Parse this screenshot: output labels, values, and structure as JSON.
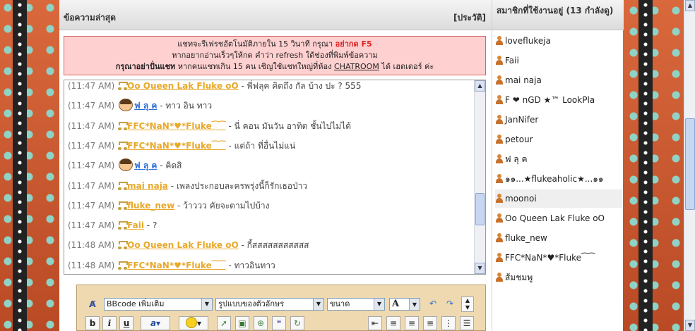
{
  "chat": {
    "header_title": "ข้อความล่าสุด",
    "history_link": "[ประวัติ]",
    "notice": {
      "line1_pre": "แชทจะรีเฟรชอัตโนมัติภายใน 15 วินาที กรุณา ",
      "line1_highlight": "อย่ากด F5",
      "line2": "หากอยากอ่านเร็วๆให้กด คำว่า refresh ใต้ช่องที่พิมพ์ข้อความ",
      "line3_bold": "กรุณาอย่าปั่นแชท",
      "line3_mid": " หากคนแชทเกิน 15 คน เชิญใช้แชทใหญ่ที่ห้อง ",
      "line3_link": "CHATROOM",
      "line3_post": " ได้ เฮดเดอร์ ค่ะ"
    },
    "messages": [
      {
        "time": "(11:47 AM)",
        "icon": "note",
        "name": "Oo Queen Lak Fluke oO",
        "text": " - พี่ฟลุค คิดถึง กัล บ้าง ปะ ? 555"
      },
      {
        "time": "(11:47 AM)",
        "icon": "face",
        "name": "ฟ ลุ ค",
        "text": " - ทาว อิน ทาว"
      },
      {
        "time": "(11:47 AM)",
        "icon": "note",
        "name": "FFC*NaN*♥*Fluke⁀⁀",
        "text": " - นี่ คอน มันวัน อาทิต ชั้นไปไม่ได้"
      },
      {
        "time": "(11:47 AM)",
        "icon": "note",
        "name": "FFC*NaN*♥*Fluke⁀⁀",
        "text": " - แต่ถ้า ที่อื่นไม่แน่"
      },
      {
        "time": "(11:47 AM)",
        "icon": "face",
        "name": "ฟ ลุ ค",
        "text": " - คิดสิ"
      },
      {
        "time": "(11:47 AM)",
        "icon": "note",
        "name": "mai naja",
        "text": " - เพลงประกอบละครพรุ่งนี้ก็รักเธอป่าว"
      },
      {
        "time": "(11:47 AM)",
        "icon": "note",
        "name": "fluke_new",
        "text": " - ว้าววว คัยจะตามไปบ้าง"
      },
      {
        "time": "(11:47 AM)",
        "icon": "note",
        "name": "Faii",
        "text": " - ?"
      },
      {
        "time": "(11:48 AM)",
        "icon": "note",
        "name": "Oo Queen Lak Fluke oO",
        "text": " - กี้สสสสสสสสสสส"
      },
      {
        "time": "(11:48 AM)",
        "icon": "note",
        "name": "FFC*NaN*♥*Fluke⁀⁀",
        "text": " - ทาวอินทาว"
      }
    ]
  },
  "editor": {
    "bbcode_select": "BBcode เพิ่มเติม",
    "font_select": "รูปแบบของตัวอักษร",
    "size_select": "ขนาด",
    "color_label": "A",
    "bold": "b",
    "italic": "i",
    "underline": "u"
  },
  "members": {
    "header": "สมาชิกที่ใช้งานอยู่ (13 กำลังดู)",
    "users": [
      "loveflukeja",
      "Faii",
      "mai naja",
      "F ❤ nGD ★™ LookPla",
      "JanNifer",
      "petour",
      "ฟ ลุ ค",
      "๑๑...★flukeaholic★...๑๑",
      "moonoi",
      "Oo Queen Lak Fluke oO",
      "fluke_new",
      "FFC*NaN*♥*Fluke⁀⁀",
      "ส้มชมพู"
    ]
  },
  "colors": {
    "accent_gold": "#e8a82a",
    "link_blue": "#2a6ed8",
    "notice_red": "#d22222",
    "notice_bg": "#ffd0d0"
  }
}
